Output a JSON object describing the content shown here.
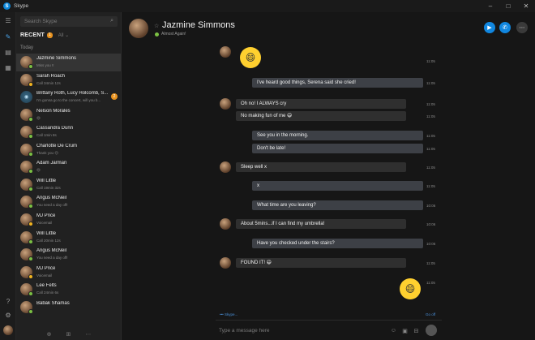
{
  "window": {
    "title": "Skype",
    "controls": {
      "minimize": "–",
      "maximize": "□",
      "close": "✕"
    }
  },
  "rail": {
    "icons": [
      "menu-icon",
      "compose-icon",
      "contacts-icon",
      "dialpad-icon",
      "help-icon",
      "settings-icon"
    ],
    "glyphs": [
      "☰",
      "✎",
      "▤",
      "▦",
      "?",
      "⚙"
    ]
  },
  "search": {
    "placeholder": "Search Skype",
    "icon": "⌕"
  },
  "recent": {
    "label": "RECENT",
    "badge": "1",
    "extra": "All ⌄"
  },
  "today_label": "Today",
  "contacts": [
    {
      "name": "Jazmine Simmons",
      "sub": "Miss you !!",
      "status": "on",
      "selected": true,
      "group": false,
      "unread": ""
    },
    {
      "name": "Sarah Roach",
      "sub": "Call 34min 12s",
      "status": "away",
      "selected": false,
      "group": false,
      "unread": ""
    },
    {
      "name": "Brittany Roth, Lucy Holcomb, S...",
      "sub": "I'm gonna go to the concert, will you b...",
      "status": "",
      "selected": false,
      "group": true,
      "unread": "2"
    },
    {
      "name": "Nelson Morales",
      "sub": "😄",
      "status": "on",
      "selected": false,
      "group": false,
      "unread": ""
    },
    {
      "name": "Cassandra Dunn",
      "sub": "Call 1min 8s",
      "status": "on",
      "selected": false,
      "group": false,
      "unread": ""
    },
    {
      "name": "Charlotte De Crum",
      "sub": "Thank you 😊",
      "status": "on",
      "selected": false,
      "group": false,
      "unread": ""
    },
    {
      "name": "Adam Jarman",
      "sub": "😄",
      "status": "on",
      "selected": false,
      "group": false,
      "unread": ""
    },
    {
      "name": "Will Little",
      "sub": "Call 19min 32s",
      "status": "on",
      "selected": false,
      "group": false,
      "unread": ""
    },
    {
      "name": "Angus McNeil",
      "sub": "You need a day off!",
      "status": "on",
      "selected": false,
      "group": false,
      "unread": ""
    },
    {
      "name": "MJ Price",
      "sub": "Voicemail",
      "status": "away",
      "selected": false,
      "group": false,
      "unread": ""
    },
    {
      "name": "Will Little",
      "sub": "Call 20min 12s",
      "status": "on",
      "selected": false,
      "group": false,
      "unread": ""
    },
    {
      "name": "Angus McNeil",
      "sub": "You need a day off!",
      "status": "on",
      "selected": false,
      "group": false,
      "unread": ""
    },
    {
      "name": "MJ Price",
      "sub": "Voicemail",
      "status": "away",
      "selected": false,
      "group": false,
      "unread": ""
    },
    {
      "name": "Lee Felts",
      "sub": "Call 24min 6s",
      "status": "on",
      "selected": false,
      "group": false,
      "unread": ""
    },
    {
      "name": "Babak Shamas",
      "sub": "",
      "status": "on",
      "selected": false,
      "group": false,
      "unread": ""
    }
  ],
  "sidebar_footer": {
    "icons": [
      "⊕",
      "⊞",
      "⋯"
    ]
  },
  "chat": {
    "contact_name": "Jazmine Simmons",
    "mood": "Almost Again!",
    "fav_icon": "☆",
    "buttons": {
      "video": "▶",
      "call": "✆",
      "more": "⋯"
    },
    "messages": [
      {
        "type": "emoji",
        "dir": "in",
        "text": "😄",
        "time": "11:05"
      },
      {
        "type": "text",
        "dir": "out",
        "text": "I've heard good things, Serena said she cried!",
        "time": "11:05"
      },
      {
        "type": "text",
        "dir": "in",
        "text": "Oh no! I ALWAYS cry",
        "time": "11:05"
      },
      {
        "type": "text",
        "dir": "in",
        "text": "No making fun of me 😄",
        "time": "11:05"
      },
      {
        "type": "text",
        "dir": "out",
        "text": "See you in the morning.",
        "time": "11:05"
      },
      {
        "type": "text",
        "dir": "out",
        "text": "Don't be late!",
        "time": "11:05"
      },
      {
        "type": "text",
        "dir": "in",
        "text": "Sleep well x",
        "time": "11:05"
      },
      {
        "type": "text",
        "dir": "out",
        "text": "x",
        "time": "11:05"
      },
      {
        "type": "text",
        "dir": "out",
        "text": "What time are you leaving?",
        "time": "10:06"
      },
      {
        "type": "text",
        "dir": "in",
        "text": "About 5mins...if I can find my umbrella!",
        "time": "10:06"
      },
      {
        "type": "text",
        "dir": "out",
        "text": "Have you checked under the stairs?",
        "time": "10:06"
      },
      {
        "type": "text",
        "dir": "in",
        "text": "FOUND IT! 😄",
        "time": "11:05"
      },
      {
        "type": "emoji",
        "dir": "out",
        "text": "😄",
        "time": "11:05"
      }
    ],
    "typing": "••• Skype...",
    "skip": "Go off",
    "compose": {
      "placeholder": "Type a message here",
      "icons": [
        "☺",
        "▣",
        "⊟"
      ]
    }
  }
}
